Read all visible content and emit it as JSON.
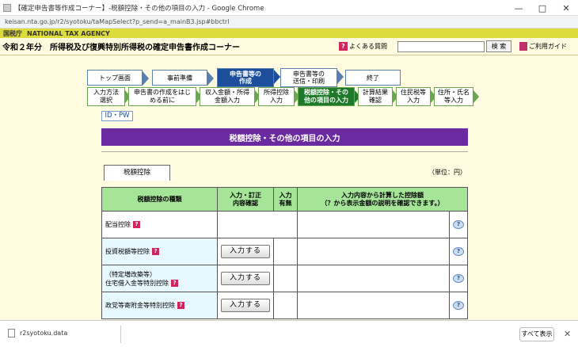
{
  "browser": {
    "title": "【確定申告書等作成コーナー】-税額控除・その他の項目の入力 - Google Chrome",
    "url": "keisan.nta.go.jp/r2/syotoku/taMapSelect?p_send=a_mainB3.jsp#bbctrl",
    "controls": [
      "—",
      "□",
      "✕"
    ]
  },
  "agency": {
    "logo": "国税庁",
    "name": "NATIONAL TAX AGENCY"
  },
  "header": {
    "title": "令和２年分　所得税及び復興特別所得税の確定申告書作成コーナー",
    "faq_label": "よくある質問",
    "search_placeholder": "",
    "search_button": "検 索",
    "guide_label": "ご利用ガイド"
  },
  "steps": [
    "トップ画面",
    "事前準備",
    "申告書等の\n作成",
    "申告書等の\n送信・印刷",
    "終了"
  ],
  "substeps": [
    "入力方法\n選択",
    "申告書の作成をはじ\nめる前に",
    "収入金額・所得\n金額入力",
    "所得控除\n入力",
    "税額控除・その\n他の項目の入力",
    "計算結果\n確認",
    "住民税等\n入力",
    "住所・氏名\n等入力"
  ],
  "id_pw_label": "ID・PW",
  "section_title": "税額控除・その他の項目の入力",
  "tab_label": "税額控除",
  "unit_label": "（単位：円）",
  "table": {
    "headers": {
      "type": "税額控除の種類",
      "entry": "入力・訂正\n内容確認",
      "status": "入力\n有無",
      "amount": "入力内容から計算した控除額\n（？から表示金額の説明を確認できます。）"
    },
    "rows": [
      {
        "label": "配当控除",
        "button": ""
      },
      {
        "label": "投資税額等控除",
        "button": "入力する"
      },
      {
        "label": "（特定増改築等）\n住宅借入金等特別控除",
        "button": "入力する"
      },
      {
        "label": "政党等寄附金等特別控除",
        "button": "入力する"
      }
    ]
  },
  "downloads": {
    "file": "r2syotoku.data",
    "show_all": "すべて表示",
    "close": "✕"
  },
  "colors": {
    "nta_band": "#dcdc3c",
    "page_bg": "#fffbe0",
    "step_active": "#1c4e9c",
    "substep_active": "#1e7a2a",
    "section_head": "#6a2aa0",
    "table_header": "#a6e49a"
  }
}
